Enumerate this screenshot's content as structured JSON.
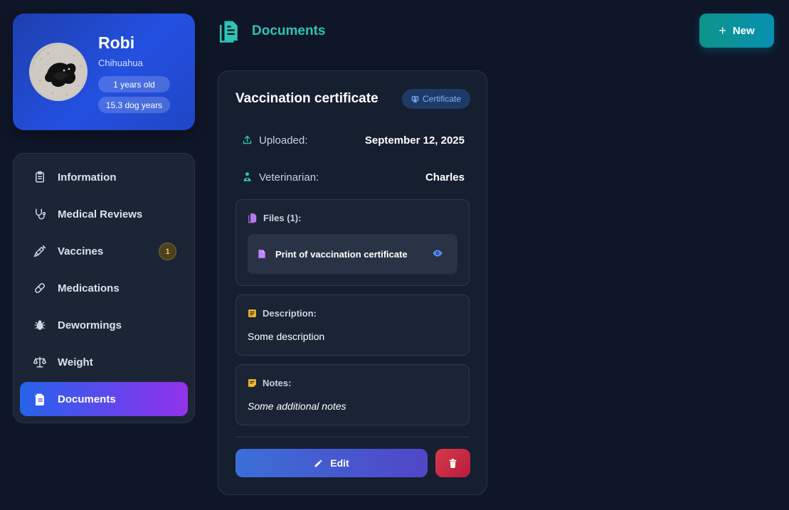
{
  "profile": {
    "name": "Robi",
    "breed": "Chihuahua",
    "age": "1 years old",
    "dog_years": "15.3 dog years"
  },
  "sidebar": {
    "items": [
      {
        "label": "Information",
        "icon": "clipboard-icon",
        "active": false
      },
      {
        "label": "Medical Reviews",
        "icon": "stethoscope-icon",
        "active": false
      },
      {
        "label": "Vaccines",
        "icon": "syringe-icon",
        "active": false,
        "badge": "1"
      },
      {
        "label": "Medications",
        "icon": "pill-icon",
        "active": false
      },
      {
        "label": "Dewormings",
        "icon": "bug-icon",
        "active": false
      },
      {
        "label": "Weight",
        "icon": "scale-icon",
        "active": false
      },
      {
        "label": "Documents",
        "icon": "document-icon",
        "active": true
      }
    ]
  },
  "header": {
    "title": "Documents",
    "new_label": "New"
  },
  "document": {
    "title": "Vaccination certificate",
    "type": "Certificate",
    "uploaded_label": "Uploaded:",
    "uploaded_value": "September 12, 2025",
    "vet_label": "Veterinarian:",
    "vet_value": "Charles",
    "files_title": "Files (1):",
    "files": [
      {
        "name": "Print of vaccination certificate"
      }
    ],
    "description_title": "Description:",
    "description": "Some description",
    "notes_title": "Notes:",
    "notes": "Some additional notes",
    "edit_label": "Edit"
  },
  "colors": {
    "background": "#0f1628",
    "accent_teal": "#2ec4b6",
    "active_gradient_start": "#2563eb",
    "active_gradient_end": "#9333ea",
    "badge_yellow": "#f5c542",
    "delete_red": "#d63a4a"
  }
}
